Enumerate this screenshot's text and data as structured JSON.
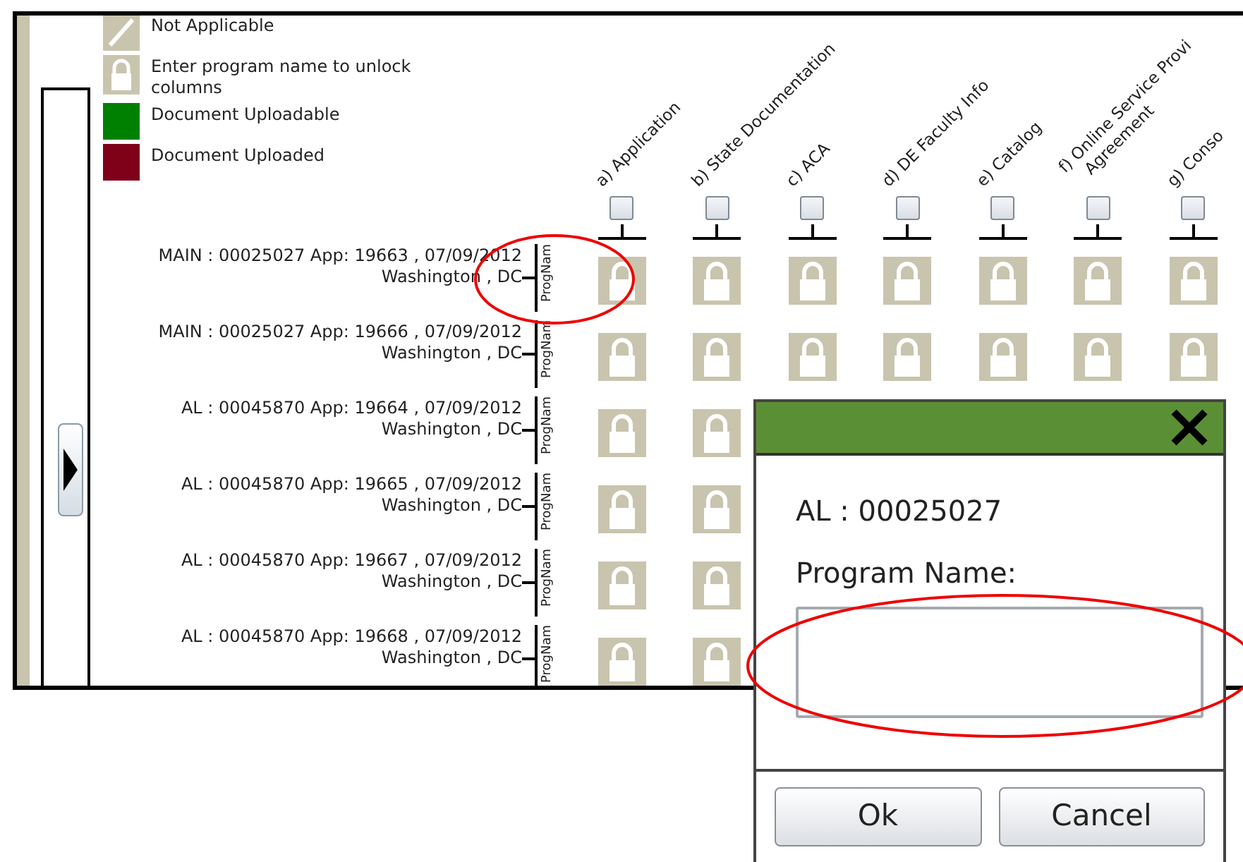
{
  "legend": [
    {
      "kind": "not_applicable",
      "label": "Not Applicable"
    },
    {
      "kind": "locked",
      "label": "Enter program name to unlock columns"
    },
    {
      "kind": "swatch",
      "label": "Document Uploadable",
      "color": "#008000"
    },
    {
      "kind": "swatch",
      "label": "Document Uploaded",
      "color": "#7f0019"
    }
  ],
  "columns": [
    {
      "lines": [
        "a) Application"
      ],
      "checked": false
    },
    {
      "lines": [
        "b) State Documentation"
      ],
      "checked": false
    },
    {
      "lines": [
        "c) ACA"
      ],
      "checked": false
    },
    {
      "lines": [
        "d) DE Faculty Info"
      ],
      "checked": false
    },
    {
      "lines": [
        "e) Catalog"
      ],
      "checked": false
    },
    {
      "lines": [
        "f) Online Service Provi",
        "Agreement"
      ],
      "checked": false
    },
    {
      "lines": [
        "g) Conso"
      ],
      "checked": false
    }
  ],
  "rows": [
    {
      "line_1": "MAIN : 00025027 App: 19663 , 07/09/2012",
      "line_2": "Washington , DC",
      "tag": "ProgNam",
      "cells": [
        {
          "kind": "locked"
        },
        {
          "kind": "locked"
        },
        {
          "kind": "locked"
        },
        {
          "kind": "locked"
        },
        {
          "kind": "locked"
        },
        {
          "kind": "locked"
        },
        {
          "kind": "locked"
        }
      ]
    },
    {
      "line_1": "MAIN : 00025027 App: 19666 , 07/09/2012",
      "line_2": "Washington , DC",
      "tag": "ProgNam",
      "cells": [
        {
          "kind": "locked"
        },
        {
          "kind": "locked"
        },
        {
          "kind": "locked"
        },
        {
          "kind": "locked"
        },
        {
          "kind": "locked"
        },
        {
          "kind": "locked"
        },
        {
          "kind": "locked"
        }
      ]
    },
    {
      "line_1": "AL : 00045870 App: 19664 , 07/09/2012",
      "line_2": "Washington , DC",
      "tag": "ProgNam",
      "cells": [
        {
          "kind": "locked"
        },
        {
          "kind": "locked"
        }
      ]
    },
    {
      "line_1": "AL : 00045870 App: 19665 , 07/09/2012",
      "line_2": "Washington , DC",
      "tag": "ProgNam",
      "cells": [
        {
          "kind": "locked"
        },
        {
          "kind": "locked"
        }
      ]
    },
    {
      "line_1": "AL : 00045870 App: 19667 , 07/09/2012",
      "line_2": "Washington , DC",
      "tag": "ProgNam",
      "cells": [
        {
          "kind": "locked"
        },
        {
          "kind": "locked"
        }
      ]
    },
    {
      "line_1": "AL : 00045870 App: 19668 , 07/09/2012",
      "line_2": "Washington , DC",
      "tag": "ProgNam",
      "cells": [
        {
          "kind": "locked"
        },
        {
          "kind": "locked"
        }
      ]
    }
  ],
  "dialog": {
    "heading": "AL : 00025027",
    "field_label": "Program Name:",
    "buttons": [
      "Ok",
      "Cancel"
    ]
  }
}
